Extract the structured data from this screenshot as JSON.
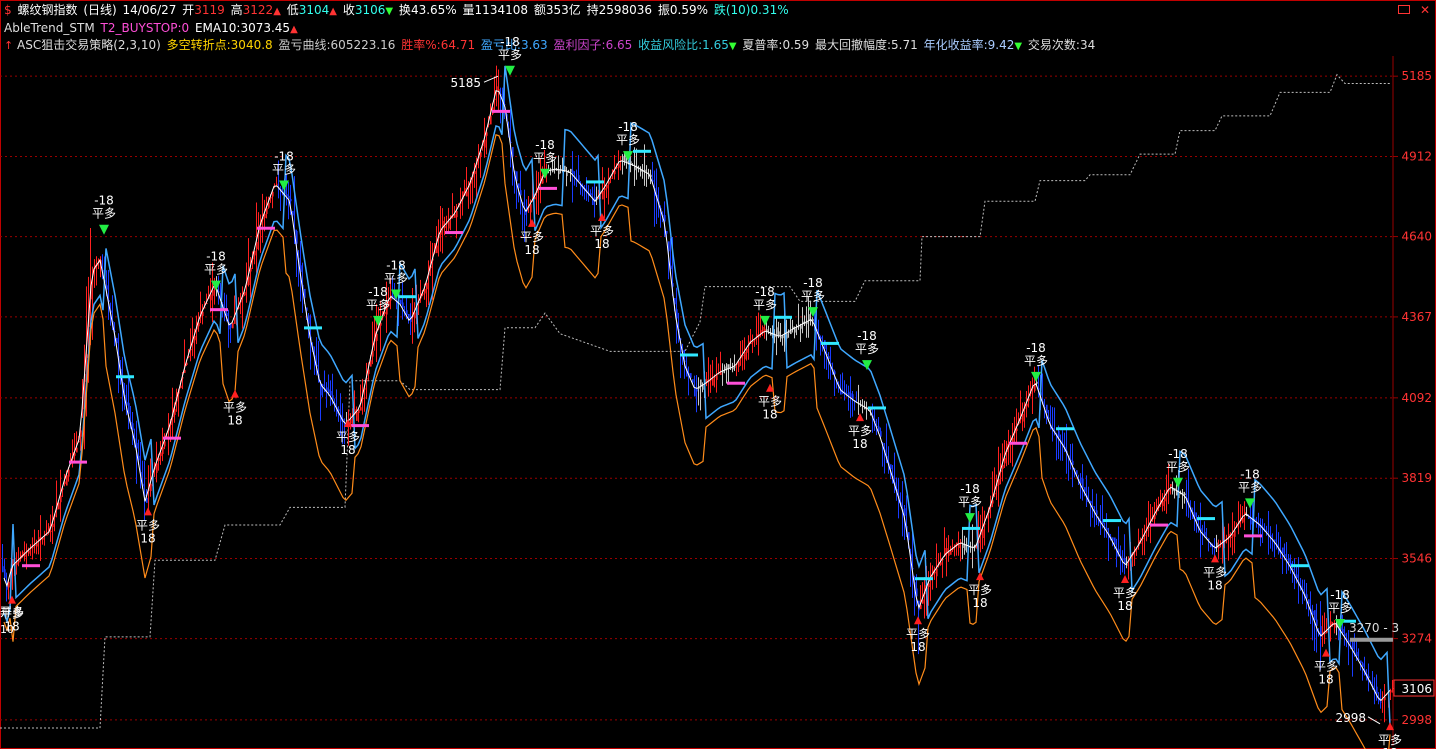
{
  "header": {
    "row1": {
      "dollar": "$",
      "instrument": "螺纹钢指数",
      "period": "(日线)",
      "date": "14/06/27",
      "open_label": "开",
      "open": "3119",
      "high_label": "高",
      "high": "3122",
      "low_label": "低",
      "low": "3104",
      "close_label": "收",
      "close": "3106",
      "turnover_label": "换",
      "turnover": "43.65%",
      "volume_label": "量",
      "volume": "1134108",
      "amount_label": "额",
      "amount": "353亿",
      "oi_label": "持",
      "oi": "2598036",
      "amp_label": "振",
      "amp": "0.59%",
      "chg_label": "跌(10)",
      "chg": "0.31%"
    },
    "row2": {
      "name": "AbleTrend_STM",
      "t2_label": "T2_BUYSTOP:",
      "t2": "0",
      "ema_label": "EMA10:",
      "ema": "3073.45"
    },
    "row3": {
      "strategy": "ASC狙击交易策略(2,3,10)",
      "pivot_label": "多空转折点:",
      "pivot": "3040.8",
      "pnl_label": "盈亏曲线:",
      "pnl": "605223.16",
      "win_label": "胜率%:",
      "win": "64.71",
      "pl_ratio_label": "盈亏比:",
      "pl_ratio": "3.63",
      "profit_factor_label": "盈利因子:",
      "profit_factor": "6.65",
      "risk_ratio_label": "收益风险比:",
      "risk_ratio": "1.65",
      "sharpe_label": "夏普率:",
      "sharpe": "0.59",
      "dd_label": "最大回撤幅度:",
      "dd": "5.71",
      "annual_label": "年化收益率:",
      "annual": "9.42",
      "trades_label": "交易次数:",
      "trades": "34"
    }
  },
  "colors": {
    "up": "#ff2020",
    "down": "#1a3cff",
    "neutral": "#c8c8c8",
    "grid": "#9a0000",
    "band_light": "#3fa8ff",
    "band_orange": "#ff8c1a",
    "ema": "#ffffff",
    "magenta": "#ff4fd8",
    "cyan": "#30e8ff",
    "equity": "#bdbdbd",
    "signal_green": "#22ee44"
  },
  "chart_data": {
    "type": "candlestick",
    "ylim": [
      2960,
      5240
    ],
    "y_ticks": [
      "5185",
      "4912",
      "4640",
      "4367",
      "4092",
      "3819",
      "3546",
      "3274",
      "2998"
    ],
    "y_values": [
      5185,
      4912,
      4640,
      4367,
      4092,
      3819,
      3546,
      3274,
      2998
    ],
    "grid": true,
    "price_trend": [
      [
        0,
        3560
      ],
      [
        6,
        3440
      ],
      [
        12,
        3520
      ],
      [
        30,
        3580
      ],
      [
        50,
        3640
      ],
      [
        65,
        3820
      ],
      [
        80,
        3960
      ],
      [
        92,
        4520
      ],
      [
        100,
        4560
      ],
      [
        106,
        4460
      ],
      [
        115,
        4300
      ],
      [
        125,
        4080
      ],
      [
        135,
        3940
      ],
      [
        145,
        3740
      ],
      [
        155,
        3860
      ],
      [
        170,
        4000
      ],
      [
        185,
        4200
      ],
      [
        200,
        4370
      ],
      [
        215,
        4480
      ],
      [
        230,
        4330
      ],
      [
        245,
        4460
      ],
      [
        260,
        4680
      ],
      [
        275,
        4820
      ],
      [
        290,
        4760
      ],
      [
        300,
        4520
      ],
      [
        310,
        4300
      ],
      [
        320,
        4140
      ],
      [
        330,
        4100
      ],
      [
        345,
        4000
      ],
      [
        360,
        4060
      ],
      [
        375,
        4300
      ],
      [
        390,
        4440
      ],
      [
        400,
        4410
      ],
      [
        410,
        4350
      ],
      [
        425,
        4470
      ],
      [
        440,
        4660
      ],
      [
        455,
        4720
      ],
      [
        470,
        4820
      ],
      [
        485,
        4980
      ],
      [
        497,
        5150
      ],
      [
        505,
        5080
      ],
      [
        515,
        4840
      ],
      [
        525,
        4720
      ],
      [
        535,
        4780
      ],
      [
        545,
        4860
      ],
      [
        555,
        4870
      ],
      [
        570,
        4860
      ],
      [
        585,
        4800
      ],
      [
        595,
        4760
      ],
      [
        605,
        4810
      ],
      [
        620,
        4900
      ],
      [
        635,
        4880
      ],
      [
        650,
        4850
      ],
      [
        665,
        4680
      ],
      [
        675,
        4380
      ],
      [
        685,
        4200
      ],
      [
        695,
        4120
      ],
      [
        705,
        4140
      ],
      [
        720,
        4180
      ],
      [
        735,
        4200
      ],
      [
        750,
        4280
      ],
      [
        765,
        4320
      ],
      [
        780,
        4300
      ],
      [
        795,
        4330
      ],
      [
        812,
        4360
      ],
      [
        825,
        4250
      ],
      [
        840,
        4120
      ],
      [
        855,
        4080
      ],
      [
        870,
        4050
      ],
      [
        880,
        3960
      ],
      [
        890,
        3850
      ],
      [
        905,
        3680
      ],
      [
        918,
        3370
      ],
      [
        930,
        3480
      ],
      [
        945,
        3560
      ],
      [
        960,
        3600
      ],
      [
        975,
        3580
      ],
      [
        990,
        3720
      ],
      [
        1005,
        3900
      ],
      [
        1020,
        4020
      ],
      [
        1035,
        4150
      ],
      [
        1050,
        4000
      ],
      [
        1065,
        3920
      ],
      [
        1080,
        3800
      ],
      [
        1095,
        3700
      ],
      [
        1110,
        3620
      ],
      [
        1125,
        3520
      ],
      [
        1140,
        3600
      ],
      [
        1155,
        3700
      ],
      [
        1170,
        3790
      ],
      [
        1185,
        3760
      ],
      [
        1200,
        3640
      ],
      [
        1215,
        3580
      ],
      [
        1230,
        3620
      ],
      [
        1245,
        3700
      ],
      [
        1260,
        3660
      ],
      [
        1275,
        3600
      ],
      [
        1290,
        3520
      ],
      [
        1305,
        3420
      ],
      [
        1320,
        3280
      ],
      [
        1335,
        3330
      ],
      [
        1350,
        3250
      ],
      [
        1365,
        3160
      ],
      [
        1380,
        3060
      ],
      [
        1392,
        3106
      ]
    ],
    "equity_curve": [
      [
        0,
        2970
      ],
      [
        100,
        2970
      ],
      [
        105,
        3280
      ],
      [
        150,
        3280
      ],
      [
        155,
        3540
      ],
      [
        215,
        3540
      ],
      [
        225,
        3660
      ],
      [
        280,
        3660
      ],
      [
        290,
        3720
      ],
      [
        345,
        3720
      ],
      [
        350,
        4150
      ],
      [
        400,
        4150
      ],
      [
        410,
        4120
      ],
      [
        500,
        4120
      ],
      [
        505,
        4330
      ],
      [
        535,
        4330
      ],
      [
        545,
        4380
      ],
      [
        560,
        4310
      ],
      [
        610,
        4250
      ],
      [
        685,
        4250
      ],
      [
        700,
        4350
      ],
      [
        705,
        4470
      ],
      [
        790,
        4470
      ],
      [
        800,
        4420
      ],
      [
        855,
        4420
      ],
      [
        865,
        4490
      ],
      [
        920,
        4490
      ],
      [
        922,
        4640
      ],
      [
        980,
        4640
      ],
      [
        985,
        4760
      ],
      [
        1035,
        4760
      ],
      [
        1040,
        4830
      ],
      [
        1085,
        4830
      ],
      [
        1090,
        4850
      ],
      [
        1130,
        4850
      ],
      [
        1140,
        4920
      ],
      [
        1175,
        4920
      ],
      [
        1180,
        5000
      ],
      [
        1215,
        5000
      ],
      [
        1222,
        5050
      ],
      [
        1270,
        5050
      ],
      [
        1280,
        5130
      ],
      [
        1330,
        5130
      ],
      [
        1337,
        5190
      ],
      [
        1345,
        5160
      ],
      [
        1390,
        5160
      ]
    ],
    "signals": [
      {
        "x": 104,
        "y": 4660,
        "type": "sell"
      },
      {
        "x": 216,
        "y": 4470,
        "type": "sell"
      },
      {
        "x": 284,
        "y": 4810,
        "type": "sell"
      },
      {
        "x": 396,
        "y": 4440,
        "type": "sell"
      },
      {
        "x": 378,
        "y": 4350,
        "type": "sell"
      },
      {
        "x": 510,
        "y": 5200,
        "type": "sell"
      },
      {
        "x": 545,
        "y": 4850,
        "type": "sell"
      },
      {
        "x": 628,
        "y": 4910,
        "type": "sell"
      },
      {
        "x": 765,
        "y": 4350,
        "type": "sell"
      },
      {
        "x": 813,
        "y": 4380,
        "type": "sell"
      },
      {
        "x": 867,
        "y": 4200,
        "type": "sell"
      },
      {
        "x": 970,
        "y": 3680,
        "type": "sell"
      },
      {
        "x": 1036,
        "y": 4160,
        "type": "sell"
      },
      {
        "x": 1178,
        "y": 3800,
        "type": "sell"
      },
      {
        "x": 1250,
        "y": 3730,
        "type": "sell"
      },
      {
        "x": 1340,
        "y": 3320,
        "type": "sell"
      },
      {
        "x": 12,
        "y": 3420,
        "type": "buy"
      },
      {
        "x": 148,
        "y": 3720,
        "type": "buy"
      },
      {
        "x": 235,
        "y": 4120,
        "type": "buy"
      },
      {
        "x": 348,
        "y": 4020,
        "type": "buy"
      },
      {
        "x": 532,
        "y": 4700,
        "type": "buy"
      },
      {
        "x": 602,
        "y": 4720,
        "type": "buy"
      },
      {
        "x": 770,
        "y": 4140,
        "type": "buy"
      },
      {
        "x": 860,
        "y": 4040,
        "type": "buy"
      },
      {
        "x": 918,
        "y": 3350,
        "type": "buy"
      },
      {
        "x": 980,
        "y": 3500,
        "type": "buy"
      },
      {
        "x": 1125,
        "y": 3490,
        "type": "buy"
      },
      {
        "x": 1215,
        "y": 3560,
        "type": "buy"
      },
      {
        "x": 1326,
        "y": 3240,
        "type": "buy"
      },
      {
        "x": 1390,
        "y": 2990,
        "type": "buy"
      }
    ],
    "annotations": {
      "high_value": "5185",
      "high_x": 498,
      "low_value": "2998",
      "low_x": 1368,
      "last_price": "3106",
      "right_marker": "3270 - 3",
      "start_label": "开多",
      "start_sub": "10",
      "sig_top": "-18",
      "sig_bottom": "18",
      "sig_text": "平多"
    }
  }
}
